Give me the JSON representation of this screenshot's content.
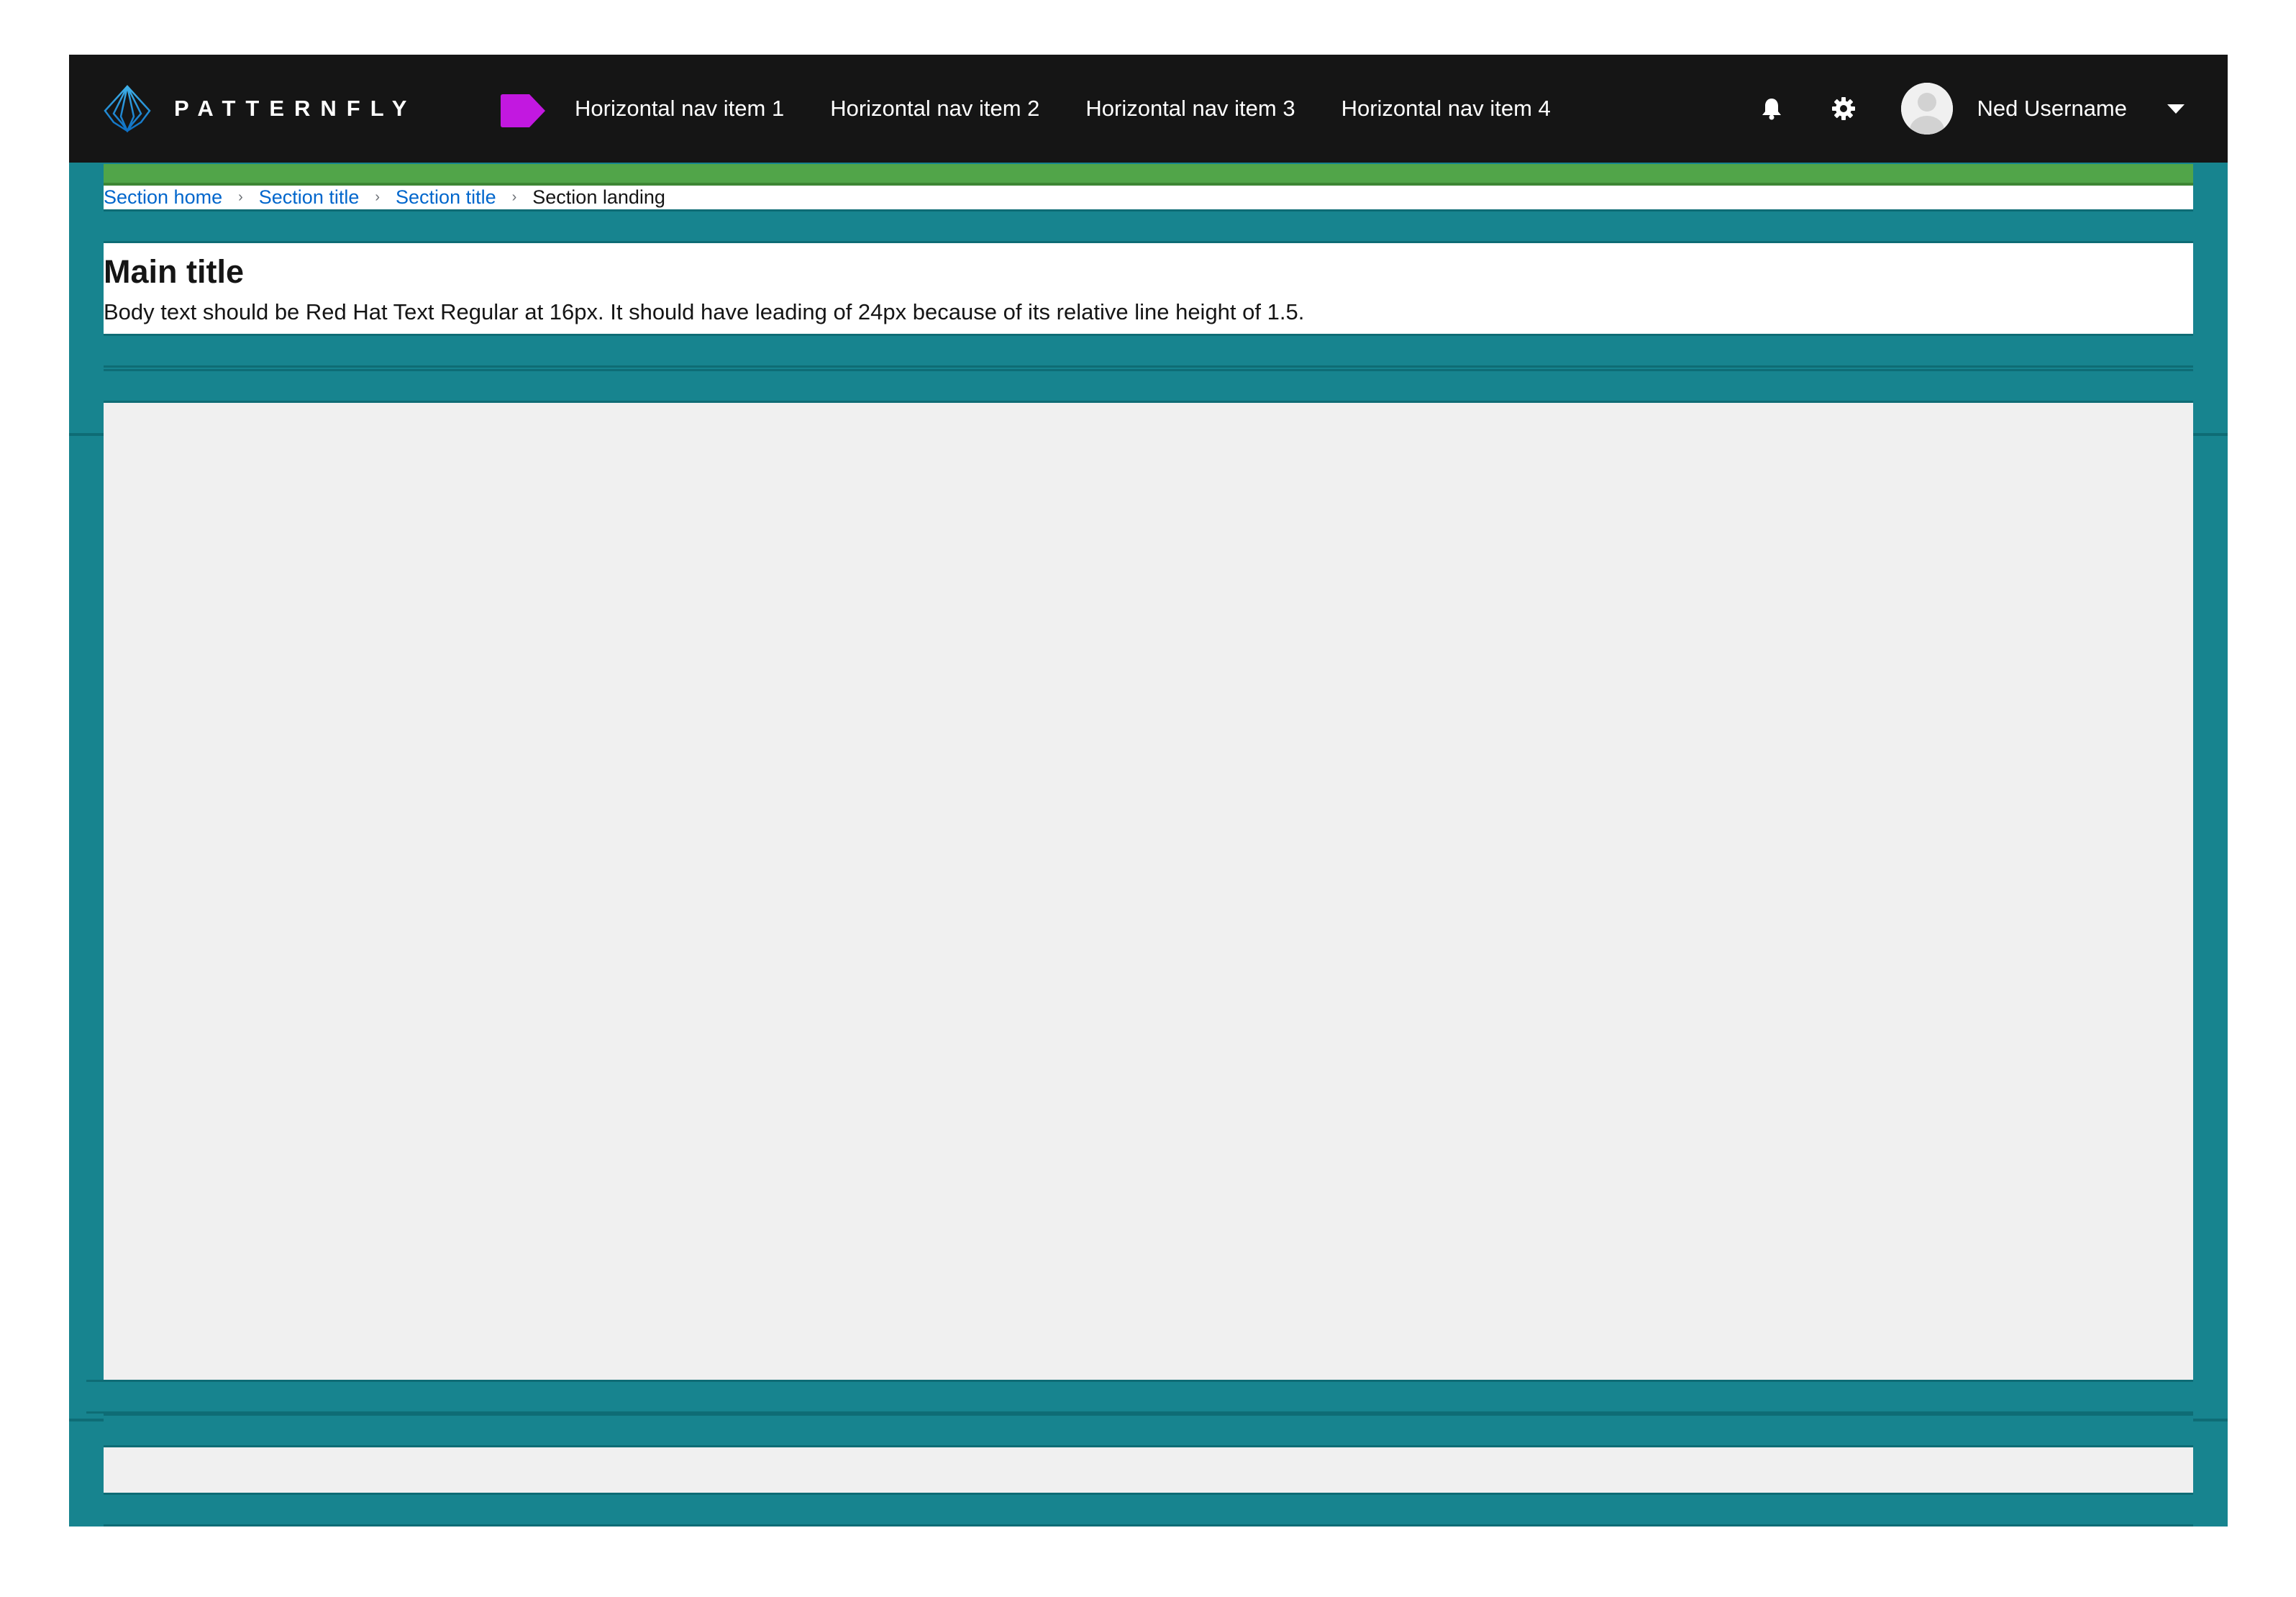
{
  "header": {
    "logo_text": "PATTERNFLY",
    "brand_mark_color": "#c218e0",
    "nav_items": [
      {
        "label": "Horizontal nav item 1"
      },
      {
        "label": "Horizontal nav item 2"
      },
      {
        "label": "Horizontal nav item 3"
      },
      {
        "label": "Horizontal nav item 4"
      }
    ],
    "tools": {
      "notifications_icon": "bell-icon",
      "settings_icon": "gear-icon"
    },
    "user": {
      "name": "Ned Username",
      "dropdown_icon": "caret-down-icon"
    }
  },
  "breadcrumb": {
    "items": [
      {
        "label": "Section home",
        "link": true
      },
      {
        "label": "Section title",
        "link": true
      },
      {
        "label": "Section title",
        "link": true
      },
      {
        "label": "Section landing",
        "link": false
      }
    ]
  },
  "page": {
    "title": "Main title",
    "body": "Body text should be Red Hat Text Regular at 16px. It should have leading of 24px because of its relative line height of 1.5."
  },
  "colors": {
    "header_bg": "#151515",
    "layout_teal": "#17848f",
    "green_bar": "#51a549",
    "link": "#0066cc",
    "content_bg": "#f0f0f0"
  }
}
